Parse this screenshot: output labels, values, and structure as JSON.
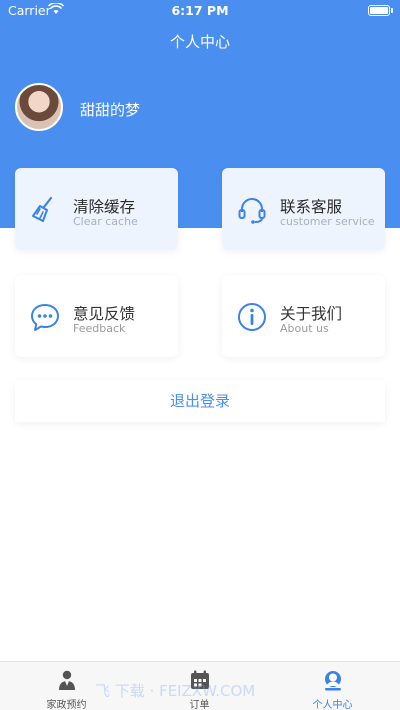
{
  "status_bar": {
    "carrier": "Carrier",
    "time": "6:17 PM"
  },
  "header": {
    "title": "个人中心"
  },
  "profile": {
    "username": "甜甜的梦"
  },
  "cards": [
    {
      "title": "清除缓存",
      "subtitle": "Clear cache",
      "icon": "broom-icon"
    },
    {
      "title": "联系客服",
      "subtitle": "customer service",
      "icon": "headset-icon"
    },
    {
      "title": "意见反馈",
      "subtitle": "Feedback",
      "icon": "chat-bubble-icon"
    },
    {
      "title": "关于我们",
      "subtitle": "About us",
      "icon": "info-icon"
    }
  ],
  "logout": {
    "label": "退出登录"
  },
  "tabbar": [
    {
      "label": "家政预约",
      "icon": "worker-icon",
      "active": false
    },
    {
      "label": "订单",
      "icon": "calendar-icon",
      "active": false
    },
    {
      "label": "个人中心",
      "icon": "user-icon",
      "active": true
    }
  ],
  "watermark": "飞 下载  · FEIZXW.COM",
  "colors": {
    "accent": "#4a8ff0",
    "background": "#ffffff",
    "tabbar": "#f7f7f7"
  }
}
